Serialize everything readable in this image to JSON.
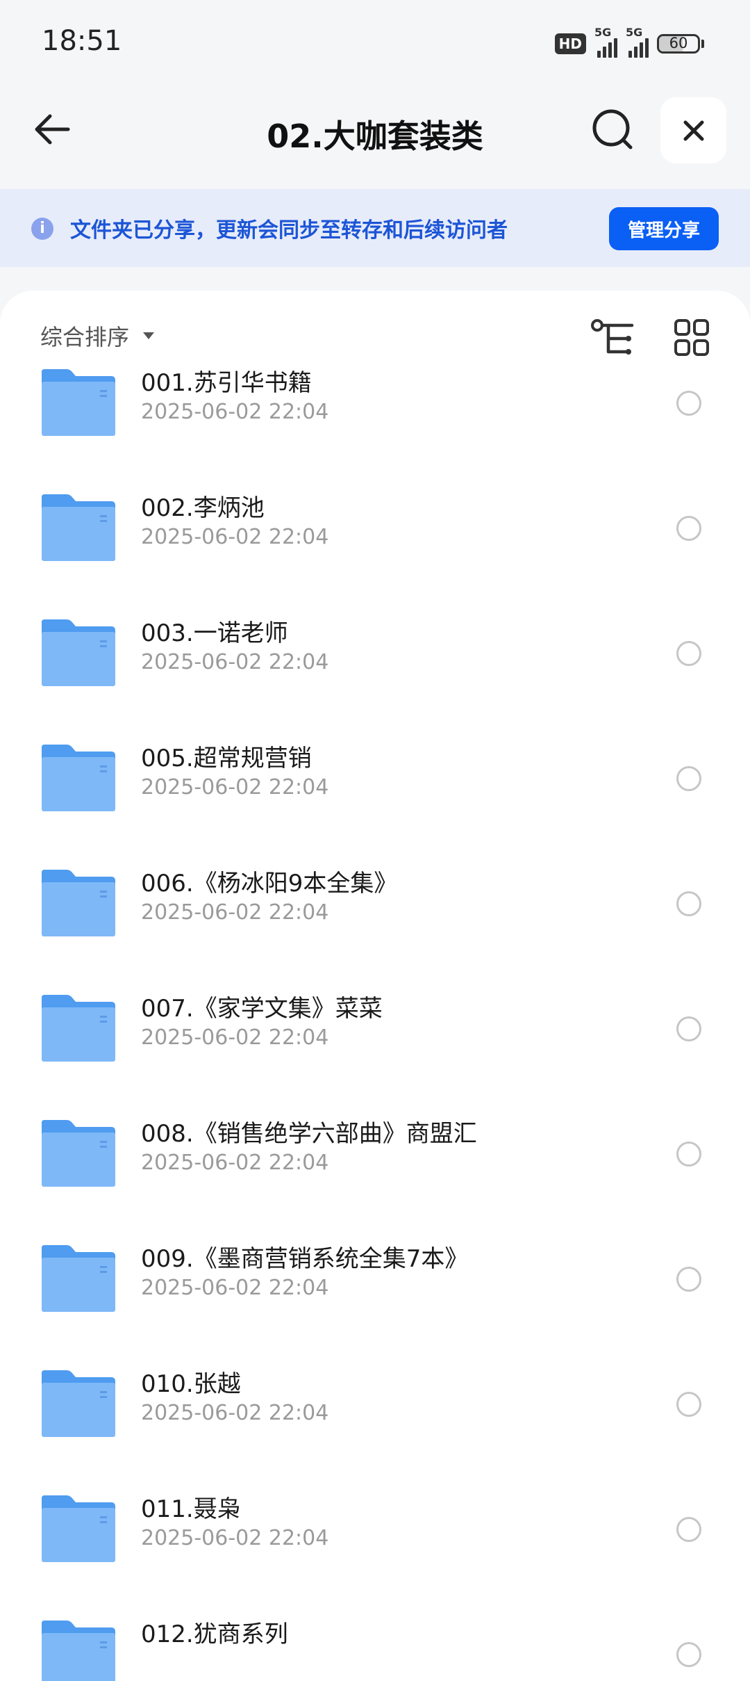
{
  "status_bar": {
    "time": "18:51",
    "hd_label": "HD",
    "network_1": "5G",
    "network_2": "5G",
    "battery_level": "60"
  },
  "header": {
    "title": "02.大咖套装类",
    "back_icon": "arrow-left-icon",
    "search_icon": "search-icon",
    "close_icon": "close-icon"
  },
  "share_banner": {
    "text": "文件夹已分享，更新会同步至转存和后续访问者",
    "button_label": "管理分享",
    "accent_color": "#0a5ff5",
    "icon": "info-icon"
  },
  "toolbar": {
    "sort_label": "综合排序",
    "sort_icon": "caret-down-icon",
    "tree_icon": "tree-view-icon",
    "grid_icon": "grid-view-icon"
  },
  "files": [
    {
      "name": "001.苏引华书籍",
      "date": "2025-06-02 22:04"
    },
    {
      "name": "002.李炳池",
      "date": "2025-06-02 22:04"
    },
    {
      "name": "003.一诺老师",
      "date": "2025-06-02 22:04"
    },
    {
      "name": "005.超常规营销",
      "date": "2025-06-02 22:04"
    },
    {
      "name": "006.《杨冰阳9本全集》",
      "date": "2025-06-02 22:04"
    },
    {
      "name": "007.《家学文集》菜菜",
      "date": "2025-06-02 22:04"
    },
    {
      "name": "008.《销售绝学六部曲》商盟汇",
      "date": "2025-06-02 22:04"
    },
    {
      "name": "009.《墨商营销系统全集7本》",
      "date": "2025-06-02 22:04"
    },
    {
      "name": "010.张越",
      "date": "2025-06-02 22:04"
    },
    {
      "name": "011.聂枭",
      "date": "2025-06-02 22:04"
    },
    {
      "name": "012.犹商系列",
      "date": ""
    }
  ]
}
